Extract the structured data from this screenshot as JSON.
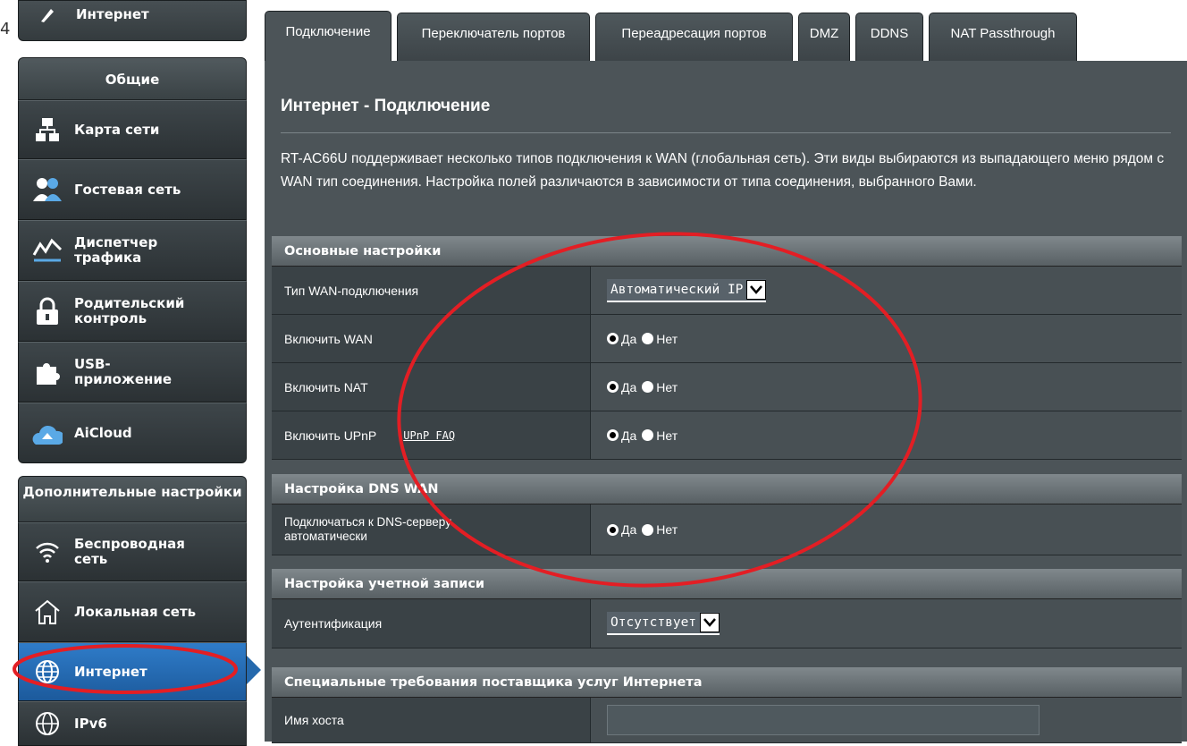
{
  "sidebar": {
    "cut_number": "4",
    "top_button": "Интернет",
    "general_header": "Общие",
    "general_items": [
      {
        "label": "Карта сети"
      },
      {
        "label": "Гостевая сеть"
      },
      {
        "label": "Диспетчер трафика"
      },
      {
        "label": "Родительский контроль"
      },
      {
        "label": "USB-приложение"
      },
      {
        "label": "AiCloud"
      }
    ],
    "advanced_header": "Дополнительные настройки",
    "advanced_items": [
      {
        "label": "Беспроводная сеть"
      },
      {
        "label": "Локальная сеть"
      },
      {
        "label": "Интернет"
      },
      {
        "label": "IPv6"
      }
    ]
  },
  "tabs": [
    {
      "label": "Подключение"
    },
    {
      "label": "Переключатель портов"
    },
    {
      "label": "Переадресация портов"
    },
    {
      "label": "DMZ"
    },
    {
      "label": "DDNS"
    },
    {
      "label": "NAT Passthrough"
    }
  ],
  "page": {
    "title": "Интернет - Подключение",
    "description": "RT-AC66U поддерживает несколько типов подключения к WAN (глобальная сеть). Эти виды выбираются из выпадающего меню рядом с WAN тип соединения. Настройка полей различаются в зависимости от типа соединения, выбранного Вами."
  },
  "basic": {
    "header": "Основные настройки",
    "wan_type_label": "Тип WAN-подключения",
    "wan_type_value": "Автоматический IP",
    "enable_wan_label": "Включить WAN",
    "enable_nat_label": "Включить NAT",
    "enable_upnp_label": "Включить UPnP",
    "upnp_faq": "UPnP FAQ"
  },
  "dns": {
    "header": "Настройка DNS WAN",
    "auto_dns_label": "Подключаться к DNS-серверу автоматически"
  },
  "account": {
    "header": "Настройка учетной записи",
    "auth_label": "Аутентификация",
    "auth_value": "Отсутствует"
  },
  "isp": {
    "header": "Специальные требования поставщика услуг Интернета",
    "hostname_label": "Имя хоста",
    "hostname_value": ""
  },
  "radio": {
    "yes": "Да",
    "no": "Нет"
  },
  "colors": {
    "annotation": "#e31e24",
    "active_item": "#2569ad"
  }
}
